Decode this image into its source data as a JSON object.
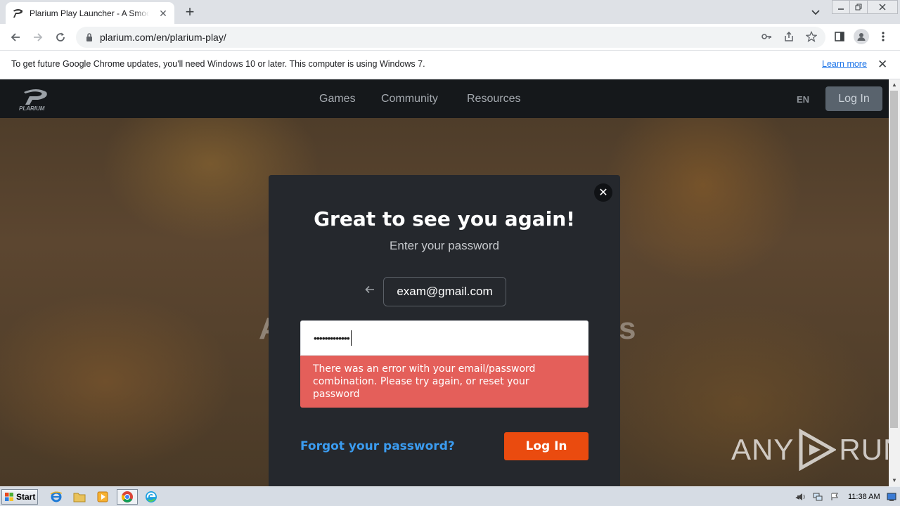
{
  "browser": {
    "tab_title": "Plarium Play Launcher - A Smoother Experience",
    "tab_close": "✕",
    "new_tab": "+",
    "url": "plarium.com/en/plarium-play/"
  },
  "infobar": {
    "message": "To get future Google Chrome updates, you'll need Windows 10 or later. This computer is using Windows 7.",
    "link": "Learn more",
    "close": "✕"
  },
  "site": {
    "nav": [
      "Games",
      "Community",
      "Resources"
    ],
    "lang": "EN",
    "login": "Log In",
    "headline_left": "A",
    "headline_right": "s"
  },
  "modal": {
    "close": "✕",
    "title": "Great to see you again!",
    "subtitle": "Enter your password",
    "email": "exam@gmail.com",
    "password_mask": "•••••••••••••",
    "error": "There was an error with your email/password combination. Please try again, or reset your password",
    "forgot": "Forgot your password?",
    "login": "Log In"
  },
  "watermark": {
    "left": "ANY",
    "right": "RUN"
  },
  "taskbar": {
    "start": "Start",
    "clock": "11:38 AM"
  },
  "colors": {
    "accent": "#ea4b0f",
    "error": "#e45f5a",
    "link": "#3b9cf0"
  }
}
